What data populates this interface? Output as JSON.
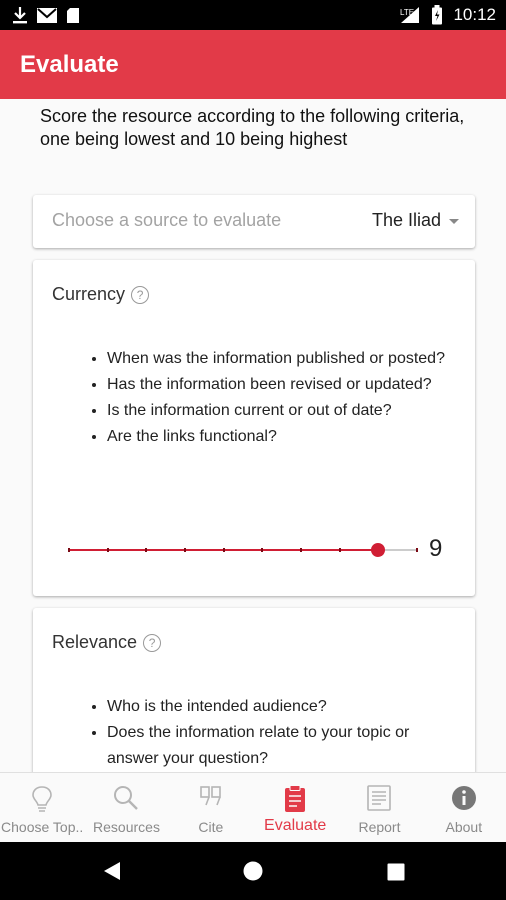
{
  "statusbar": {
    "time": "10:12",
    "network": "LTE"
  },
  "appbar": {
    "title": "Evaluate"
  },
  "intro": "Score the resource according to the following criteria, one being lowest and 10 being highest",
  "source": {
    "placeholder": "Choose a source to evaluate",
    "selected": "The Iliad"
  },
  "criteria": [
    {
      "title": "Currency",
      "questions": [
        "When was the information published or posted?",
        "Has the information been revised or updated?",
        "Is the information current or out of date?",
        "Are the links functional?"
      ],
      "score": 9,
      "score_max": 10
    },
    {
      "title": "Relevance",
      "questions": [
        "Who is the intended audience?",
        "Does the information relate to your topic or answer your question?"
      ]
    }
  ],
  "bottom_nav": [
    {
      "label": "Choose Top..",
      "icon": "lightbulb-icon"
    },
    {
      "label": "Resources",
      "icon": "search-icon"
    },
    {
      "label": "Cite",
      "icon": "quote-icon"
    },
    {
      "label": "Evaluate",
      "icon": "clipboard-icon",
      "active": true
    },
    {
      "label": "Report",
      "icon": "report-icon"
    },
    {
      "label": "About",
      "icon": "info-icon"
    }
  ],
  "colors": {
    "accent": "#e23a48",
    "slider": "#d01e34"
  }
}
